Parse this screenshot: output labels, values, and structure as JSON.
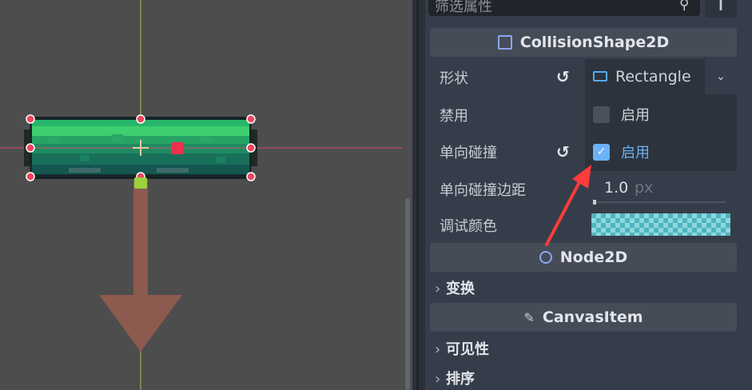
{
  "viewport": {
    "background": "#4d4d4d",
    "guide_vertical_color": "#a6c64c",
    "guide_horizontal_color": "#d24a74"
  },
  "inspector": {
    "filter_placeholder": "筛选属性",
    "sections": {
      "collision": {
        "title": "CollisionShape2D",
        "icon": "collision-shape-icon"
      },
      "node2d": {
        "title": "Node2D",
        "icon": "node2d-icon"
      },
      "canvas": {
        "title": "CanvasItem",
        "icon": "brush-icon"
      }
    },
    "properties": {
      "shape": {
        "label": "形状",
        "value": "Rectangle",
        "icon": "rectangle-icon"
      },
      "disabled": {
        "label": "禁用"
      },
      "one_way": {
        "label": "单向碰撞"
      },
      "one_way_margin": {
        "label": "单向碰撞边距",
        "value": "1.0",
        "unit": "px"
      },
      "debug_color": {
        "label": "调试颜色",
        "color": "#8fd7dd"
      }
    },
    "dropdown": {
      "items": [
        {
          "label": "启用",
          "checked": false
        },
        {
          "label": "启用",
          "checked": true
        }
      ]
    },
    "folds": {
      "transform": "变换",
      "visibility": "可见性",
      "ordering": "排序"
    }
  },
  "colors": {
    "accent": "#6cb2f7",
    "annotation_arrow": "#ff3b3b"
  }
}
